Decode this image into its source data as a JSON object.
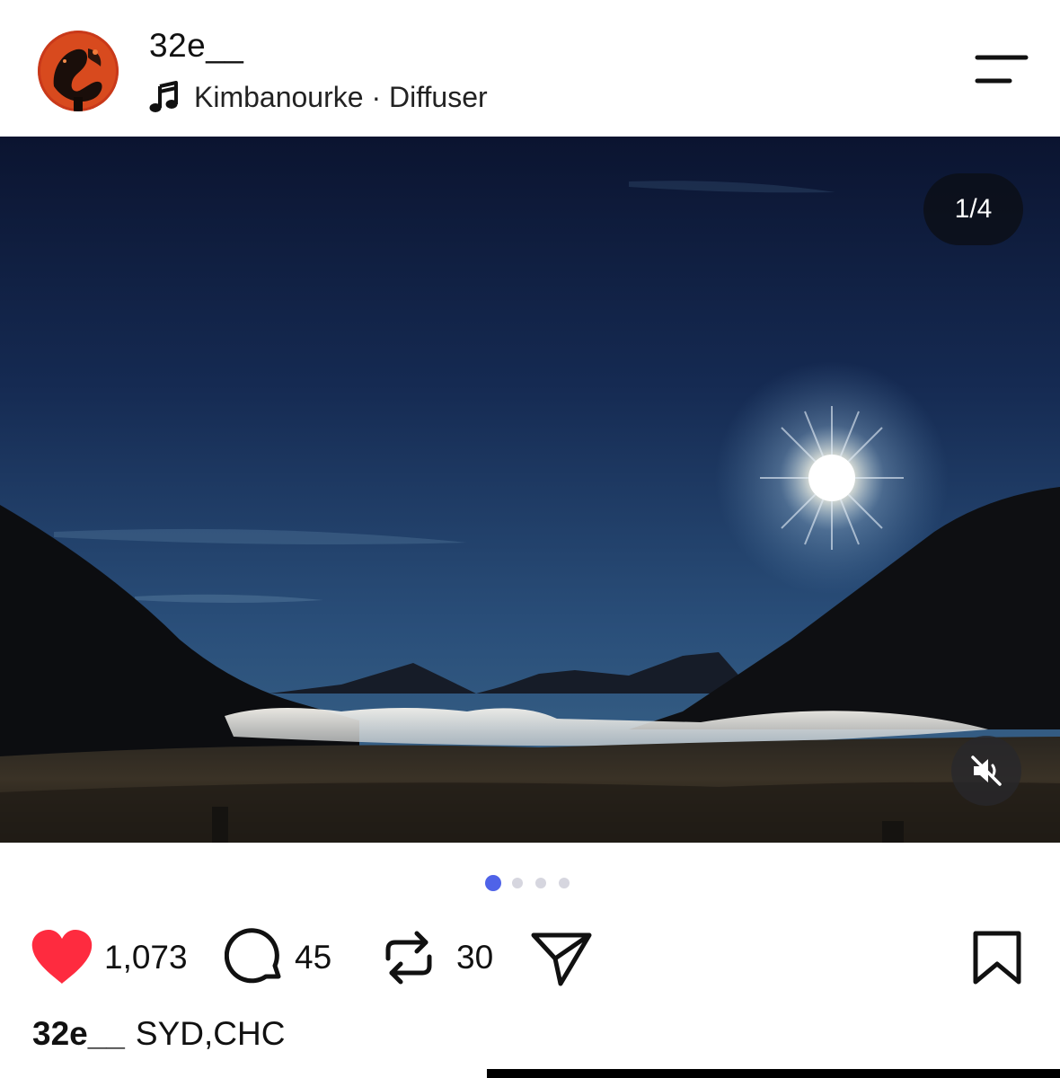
{
  "post": {
    "username": "32e__",
    "music_label": "Kimbanourke · Diffuser",
    "image_counter": "1/4",
    "carousel": {
      "total": 4,
      "active_index": 0
    },
    "stats": {
      "likes": "1,073",
      "comments": "45",
      "reposts": "30"
    },
    "liked": true,
    "caption": {
      "username": "32e__",
      "text": "SYD,CHC"
    }
  },
  "icons": {
    "menu": "menu-icon",
    "music": "music-note-icon",
    "mute": "speaker-muted-icon",
    "like": "heart-icon",
    "comment": "comment-bubble-icon",
    "repost": "repost-icon",
    "share": "send-icon",
    "save": "bookmark-icon"
  },
  "colors": {
    "like_red": "#fe2b3f",
    "dot_active": "#4f63e8",
    "dot_inactive": "#d6d6df",
    "avatar_orange": "#c8380f"
  }
}
